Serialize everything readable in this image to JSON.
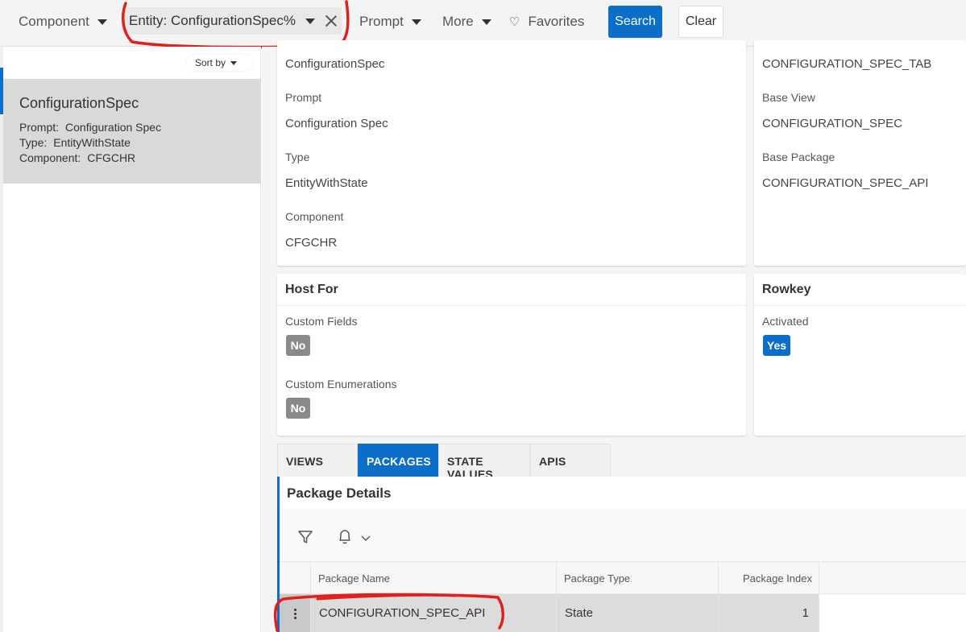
{
  "topbar": {
    "component_label": "Component",
    "entity_filter": "Entity: ConfigurationSpec%",
    "prompt_label": "Prompt",
    "more_label": "More",
    "favorites_label": "Favorites",
    "search_label": "Search",
    "clear_label": "Clear"
  },
  "sidebar": {
    "sort_label": "Sort by",
    "item": {
      "title": "ConfigurationSpec",
      "prompt_key": "Prompt:",
      "prompt_val": "Configuration Spec",
      "type_key": "Type:",
      "type_val": "EntityWithState",
      "component_key": "Component:",
      "component_val": "CFGCHR"
    }
  },
  "general": {
    "name_val": "ConfigurationSpec",
    "prompt_label": "Prompt",
    "prompt_val": "Configuration Spec",
    "type_label": "Type",
    "type_val": "EntityWithState",
    "component_label": "Component",
    "component_val": "CFGCHR"
  },
  "database": {
    "table_val": "CONFIGURATION_SPEC_TAB",
    "base_view_label": "Base View",
    "base_view_val": "CONFIGURATION_SPEC",
    "base_package_label": "Base Package",
    "base_package_val": "CONFIGURATION_SPEC_API"
  },
  "host_for": {
    "title": "Host For",
    "custom_fields_label": "Custom Fields",
    "custom_fields_val": "No",
    "custom_enums_label": "Custom Enumerations",
    "custom_enums_val": "No"
  },
  "rowkey": {
    "title": "Rowkey",
    "activated_label": "Activated",
    "activated_val": "Yes"
  },
  "tabs": [
    "VIEWS",
    "PACKAGES",
    "STATE VALUES",
    "APIS"
  ],
  "packages": {
    "title": "Package Details",
    "columns": [
      "Package Name",
      "Package Type",
      "Package Index"
    ],
    "rows": [
      {
        "name": "CONFIGURATION_SPEC_API",
        "type": "State",
        "index": "1"
      }
    ]
  },
  "colors": {
    "accent": "#0b6fc9",
    "annotation": "#e0201b"
  },
  "icons": [
    "caret-down-icon",
    "close-icon",
    "heart-icon",
    "filter-icon",
    "bell-icon",
    "chevron-down-icon",
    "kebab-icon"
  ]
}
